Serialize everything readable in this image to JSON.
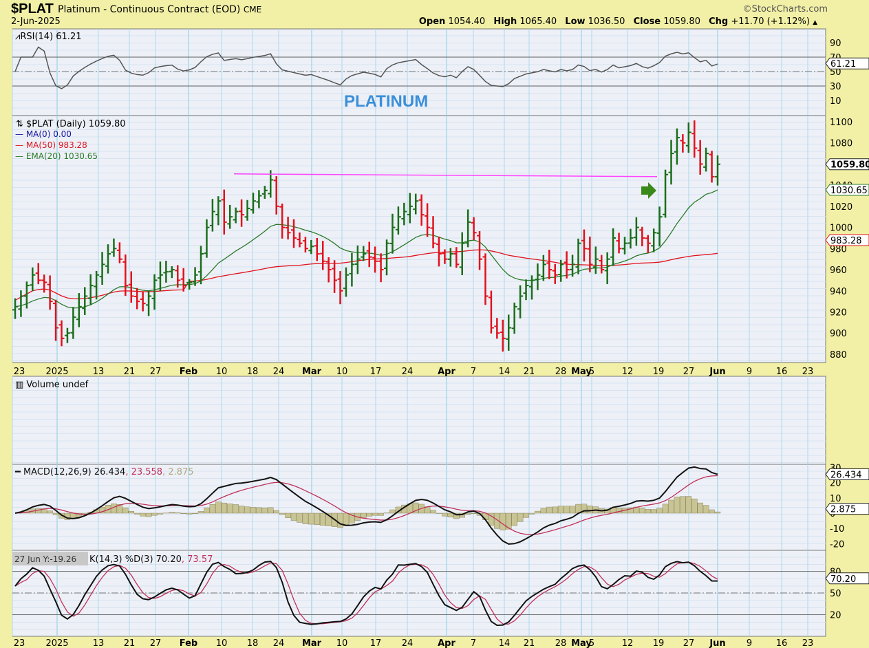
{
  "header": {
    "symbol": "$PLAT",
    "name": "Platinum - Continuous Contract (EOD)",
    "exchange": "CME",
    "date": "2-Jun-2025",
    "copyright": "©StockCharts.com",
    "open_label": "Open",
    "open": "1054.40",
    "high_label": "High",
    "high": "1065.40",
    "low_label": "Low",
    "low": "1036.50",
    "close_label": "Close",
    "close": "1059.80",
    "chg_label": "Chg",
    "chg": "+11.70 (+1.12%)"
  },
  "annotation": "PLATINUM",
  "colors": {
    "up": "#1a6e1a",
    "down": "#e0121c",
    "ma50": "#e0121c",
    "ema20": "#2a7a2a",
    "rsi": "#555555",
    "macd": "#111111",
    "signal": "#c0305a",
    "hist": "#c8c494",
    "stoch_k": "#111111",
    "stoch_d": "#c0305a",
    "resistance": "#ff44ff",
    "arrow": "#3a8a1a",
    "annotation": "#3a8fd9"
  },
  "chart_data": {
    "type": "ohlc",
    "title": "$PLAT (Daily) 1059.80",
    "legend": {
      "ma0": "MA(0) 0.00",
      "ma50": "MA(50) 983.28",
      "ema20": "EMA(20) 1030.65"
    },
    "closes": [
      925,
      935,
      945,
      955,
      950,
      948,
      930,
      905,
      895,
      900,
      915,
      925,
      935,
      945,
      955,
      965,
      975,
      980,
      970,
      945,
      935,
      930,
      928,
      935,
      950,
      955,
      958,
      960,
      950,
      945,
      948,
      955,
      975,
      1000,
      1015,
      1025,
      1005,
      1010,
      1015,
      1012,
      1018,
      1025,
      1030,
      1035,
      1045,
      1020,
      1000,
      995,
      990,
      985,
      980,
      982,
      975,
      968,
      960,
      950,
      940,
      955,
      965,
      970,
      975,
      972,
      968,
      960,
      985,
      1000,
      1010,
      1015,
      1020,
      1025,
      1012,
      1000,
      985,
      975,
      970,
      975,
      965,
      985,
      1005,
      995,
      970,
      935,
      905,
      900,
      895,
      905,
      925,
      935,
      945,
      950,
      955,
      965,
      960,
      955,
      965,
      960,
      965,
      985,
      980,
      965,
      970,
      960,
      970,
      990,
      980,
      985,
      990,
      1000,
      990,
      985,
      995,
      1010,
      1050,
      1070,
      1085,
      1080,
      1090,
      1075,
      1060,
      1070,
      1048,
      1059.8
    ],
    "x_ticks": [
      "23",
      "2025",
      "13",
      "21",
      "27",
      "Feb",
      "10",
      "18",
      "24",
      "Mar",
      "10",
      "17",
      "24",
      "Apr",
      "7",
      "14",
      "21",
      "28",
      "May",
      "5",
      "12",
      "19",
      "27",
      "Jun",
      "9",
      "16",
      "23"
    ],
    "y_ticks": [
      880,
      900,
      920,
      940,
      960,
      980,
      1000,
      1020,
      1040,
      1060,
      1080,
      1100
    ],
    "price_labels": {
      "close": "1059.80",
      "ema20": "1030.65",
      "ma50": "983.28"
    },
    "resistance_level": 1050,
    "rsi": {
      "legend": "RSI(14) 61.21",
      "value": "61.21",
      "ticks": [
        "90",
        "70",
        "50",
        "30",
        "10"
      ]
    },
    "volume": {
      "legend": "Volume undef"
    },
    "macd": {
      "legend_main": "MACD(12,26,9) 26.434",
      "legend_signal": ", 23.558",
      "legend_hist": ", 2.875",
      "value": "26.434",
      "hist_value": "2.875",
      "ticks": [
        "30",
        "20",
        "10",
        "0",
        "-10",
        "-20"
      ]
    },
    "stoch": {
      "tooltip": "27 Jun Y:-19.26",
      "legend_main": "K(14,3) %D(3) 70.20",
      "legend_d": ", 73.57",
      "value": "70.20",
      "ticks": [
        "80",
        "50",
        "20"
      ]
    }
  }
}
